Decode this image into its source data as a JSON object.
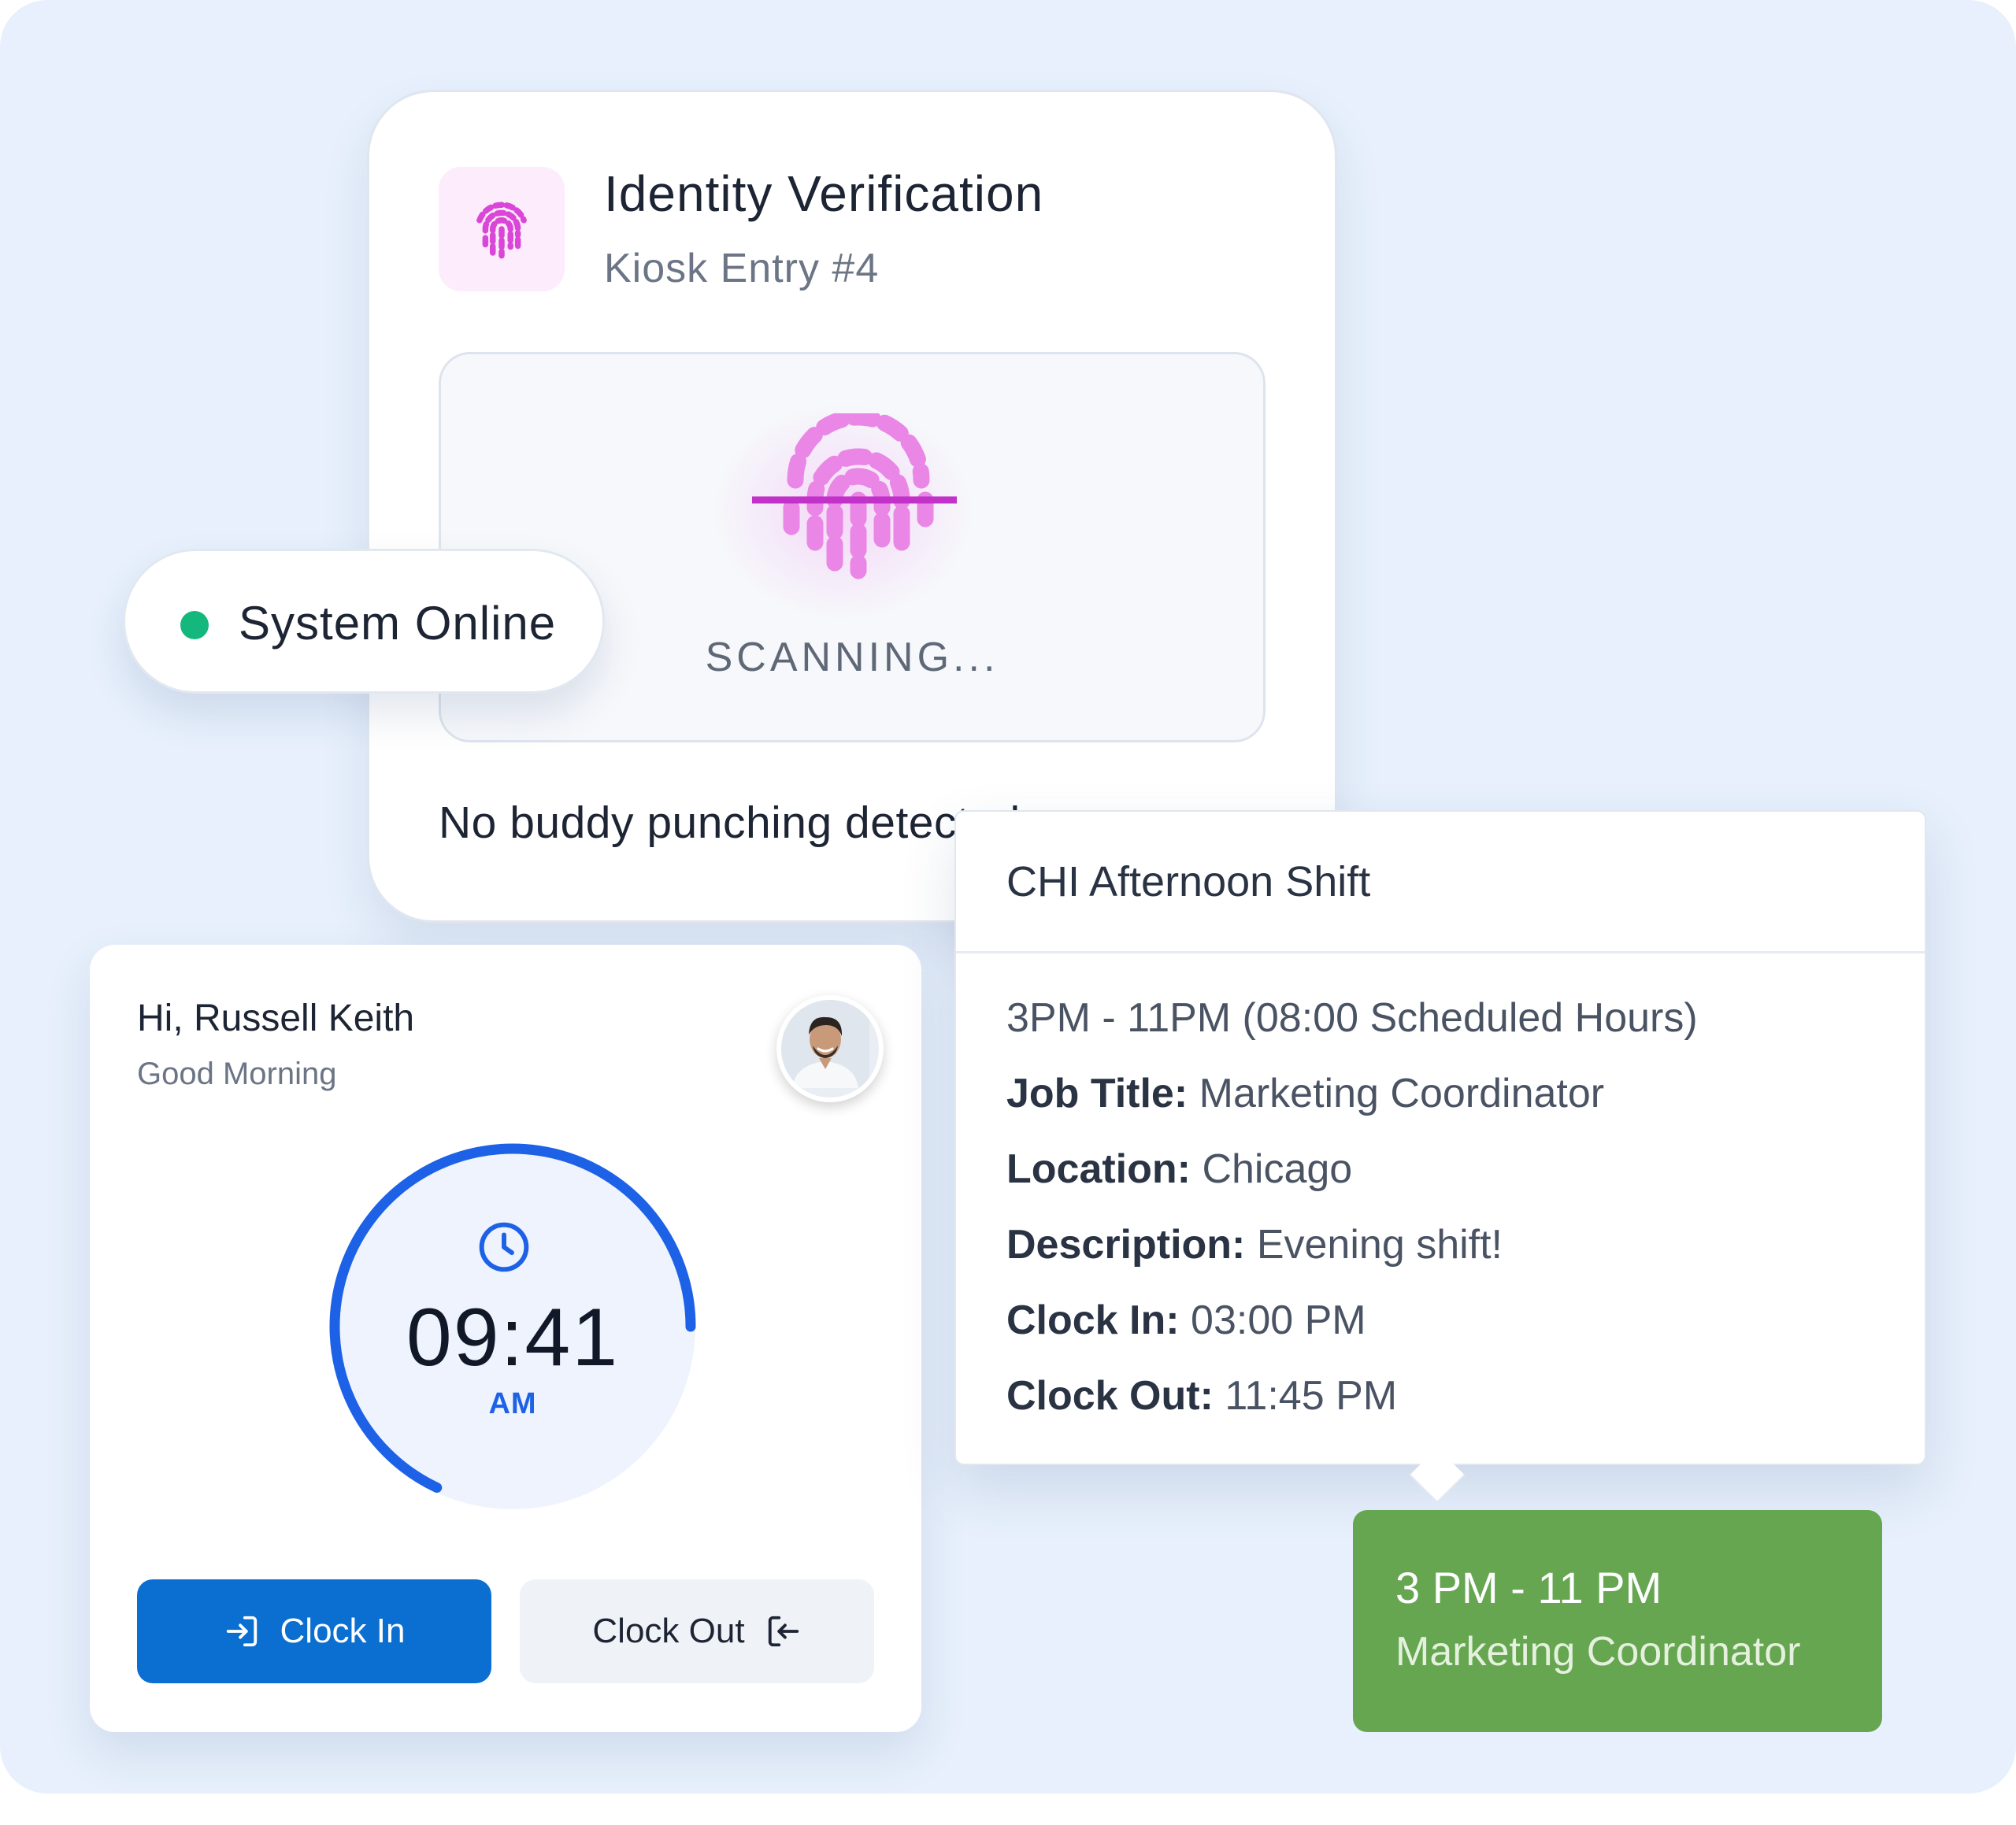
{
  "identity": {
    "title": "Identity Verification",
    "subtitle": "Kiosk Entry #4",
    "scan_status": "SCANNING...",
    "message": "No buddy punching detected",
    "accent_color": "#e45ae0"
  },
  "status_pill": {
    "label": "System Online",
    "dot_color": "#14b87c"
  },
  "clock_widget": {
    "greeting": "Hi, Russell Keith",
    "salutation": "Good Morning",
    "time": "09:41",
    "meridiem": "AM",
    "progress": 0.68,
    "accent_color": "#1d62e6",
    "clock_in_label": "Clock In",
    "clock_out_label": "Clock Out",
    "clock_in_color": "#0b6fd1"
  },
  "shift_details": {
    "title": "CHI Afternoon Shift",
    "hours_line": "3PM - 11PM (08:00 Scheduled Hours)",
    "rows": [
      {
        "label": "Job Title:",
        "value": "Marketing Coordinator"
      },
      {
        "label": "Location:",
        "value": "Chicago"
      },
      {
        "label": "Description:",
        "value": "Evening shift!"
      },
      {
        "label": "Clock In:",
        "value": "03:00 PM"
      },
      {
        "label": "Clock Out:",
        "value": "11:45 PM"
      }
    ]
  },
  "shift_chip": {
    "time": "3 PM - 11 PM",
    "role": "Marketing Coordinator",
    "color": "#66a651"
  }
}
